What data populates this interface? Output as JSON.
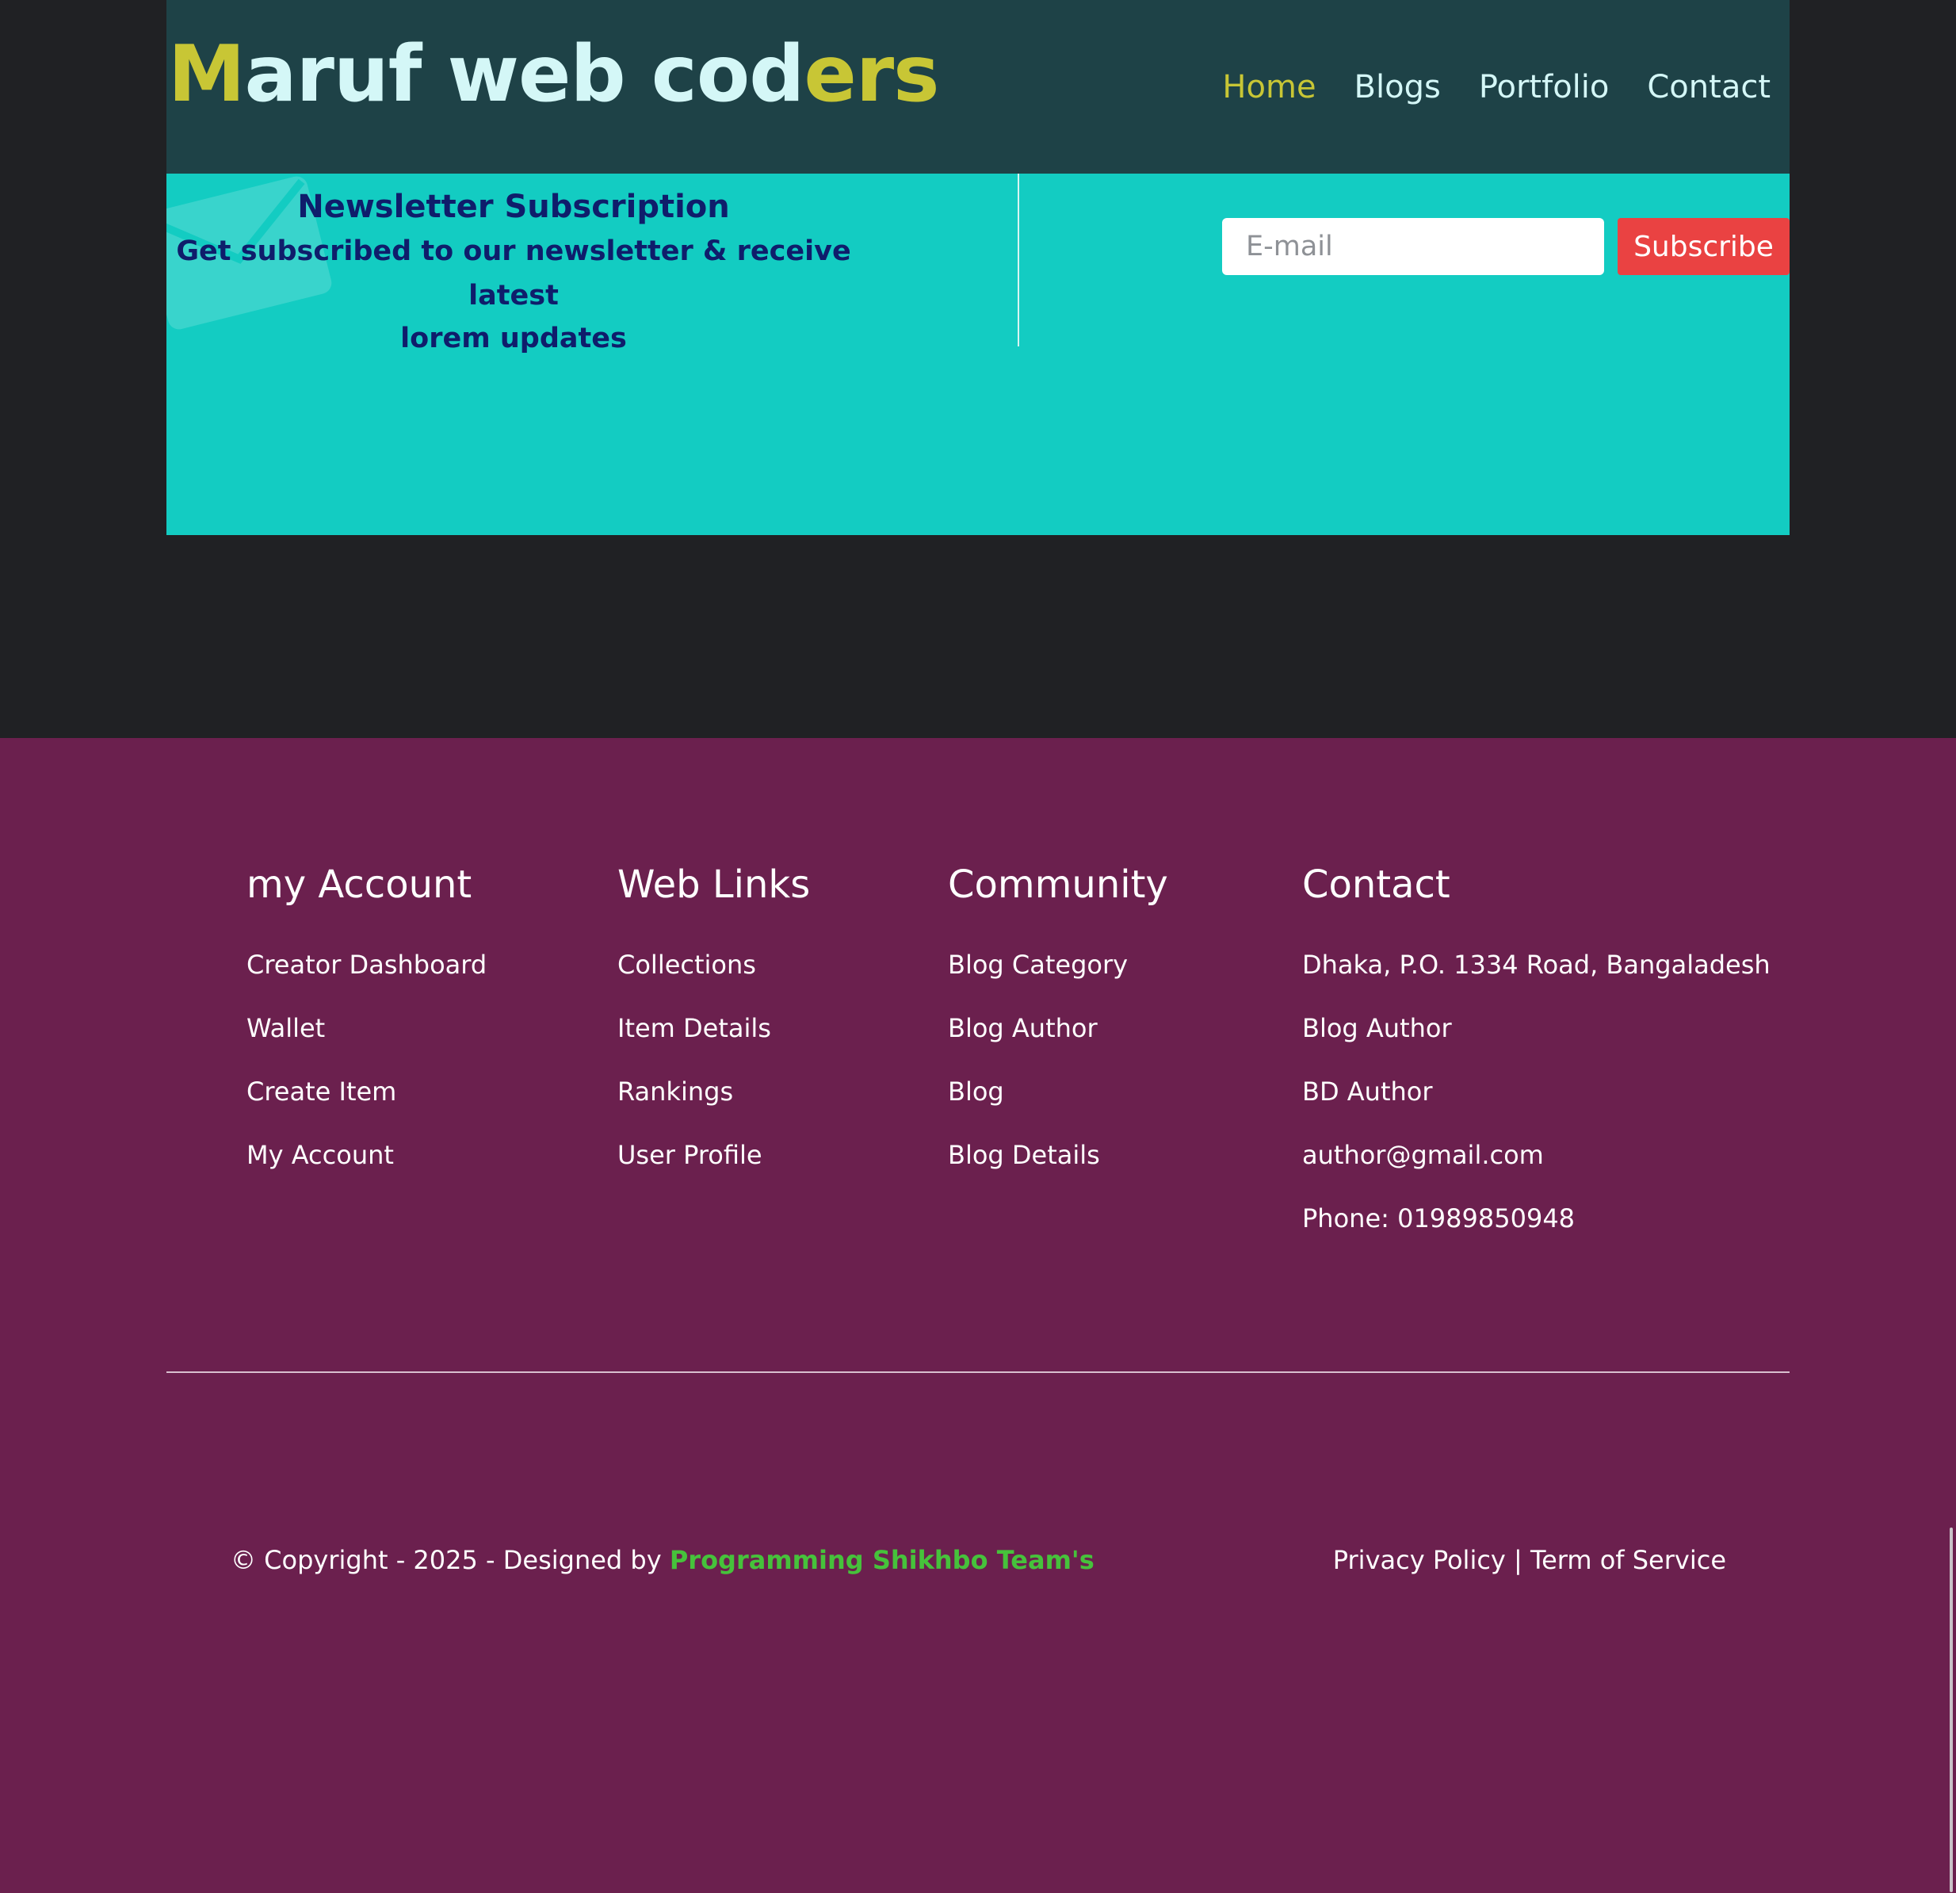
{
  "header": {
    "logo": {
      "first_letter": "M",
      "middle": "aruf web cod",
      "end": "ers"
    },
    "nav": [
      {
        "label": "Home",
        "active": true
      },
      {
        "label": "Blogs",
        "active": false
      },
      {
        "label": "Portfolio",
        "active": false
      },
      {
        "label": "Contact",
        "active": false
      }
    ]
  },
  "newsletter": {
    "title": "Newsletter Subscription",
    "subtitle_line1": "Get subscribed to our newsletter & receive latest",
    "subtitle_line2": "lorem updates",
    "email_placeholder": "E-mail",
    "email_value": "",
    "subscribe_label": "Subscribe"
  },
  "footer": {
    "columns": [
      {
        "heading": "my Account",
        "items": [
          "Creator Dashboard",
          "Wallet",
          "Create Item",
          "My Account"
        ]
      },
      {
        "heading": "Web Links",
        "items": [
          "Collections",
          "Item Details",
          "Rankings",
          "User Profile"
        ]
      },
      {
        "heading": "Community",
        "items": [
          "Blog Category",
          "Blog Author",
          "Blog",
          "Blog Details"
        ]
      },
      {
        "heading": "Contact",
        "items": [
          "Dhaka, P.O. 1334 Road, Bangaladesh",
          "Blog Author",
          "BD Author",
          "author@gmail.com",
          "Phone: 01989850948"
        ]
      }
    ],
    "copyright_prefix": "© Copyright - 2025 - Designed by ",
    "copyright_team": "Programming Shikhbo Team's",
    "privacy_label": "Privacy Policy",
    "legal_separator": " | ",
    "terms_label": "Term of Service"
  },
  "colors": {
    "header_bg": "#1e4247",
    "accent_yellow": "#c8c635",
    "newsletter_bg": "#13ccc2",
    "newsletter_text": "#0f1d6b",
    "subscribe_button": "#ea4242",
    "footer_bg": "#6b204e",
    "team_link": "#46c23b",
    "page_bg": "#202124"
  }
}
